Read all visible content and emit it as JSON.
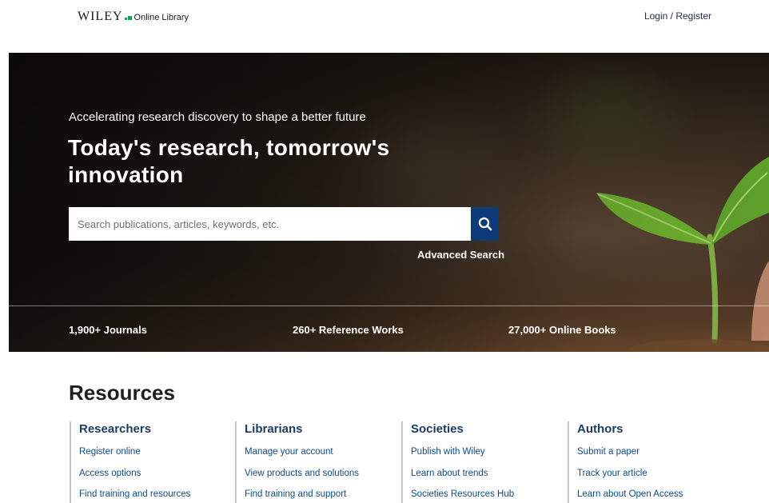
{
  "header": {
    "logo_wordmark": "WILEY",
    "logo_product": "Online Library",
    "login_label": "Login / Register"
  },
  "hero": {
    "tagline": "Accelerating research discovery to shape a better future",
    "headline": "Today's research, tomorrow's innovation",
    "search": {
      "placeholder": "Search publications, articles, keywords, etc.",
      "value": "",
      "button_icon": "search-icon"
    },
    "advanced_search_label": "Advanced Search",
    "stats": [
      "1,900+ Journals",
      "260+ Reference Works",
      "27,000+ Online Books"
    ]
  },
  "resources": {
    "title": "Resources",
    "columns": [
      {
        "heading": "Researchers",
        "links": [
          "Register online",
          "Access options",
          "Find training and resources"
        ]
      },
      {
        "heading": "Librarians",
        "links": [
          "Manage your account",
          "View products and solutions",
          "Find training and support"
        ]
      },
      {
        "heading": "Societies",
        "links": [
          "Publish with Wiley",
          "Learn about trends",
          "Societies Resources Hub"
        ]
      },
      {
        "heading": "Authors",
        "links": [
          "Submit a paper",
          "Track your article",
          "Learn about Open Access"
        ]
      }
    ]
  },
  "colors": {
    "brand_green": "#1aa34a",
    "search_button": "#0d3b7a",
    "heading_navy": "#1f3b63",
    "link_blue": "#0d4a8c"
  }
}
